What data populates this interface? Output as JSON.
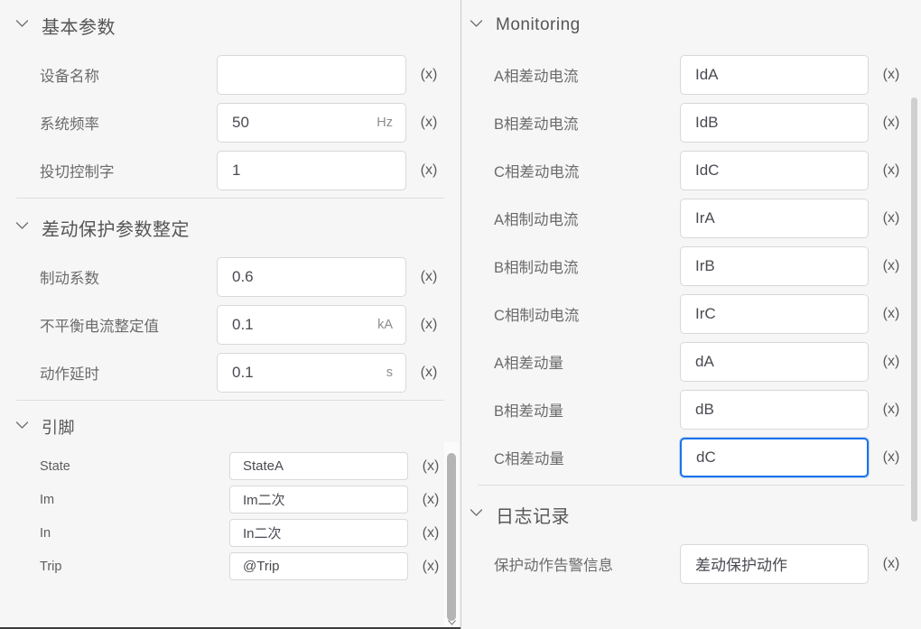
{
  "icons": {
    "chevron": "chevron-down-icon",
    "expression": "(x)"
  },
  "colors": {
    "focus_border": "#1a73e8",
    "panel_bg": "#f6f6f6",
    "field_bg": "#ffffff",
    "field_border": "#d8d8d8",
    "label_text": "#6b6b6b",
    "title_text": "#555555"
  },
  "left_panel": {
    "sections": [
      {
        "title": "基本参数",
        "collapsed": false,
        "rows": [
          {
            "label": "设备名称",
            "value": "",
            "unit": "",
            "expr": "(x)",
            "focused": false
          },
          {
            "label": "系统频率",
            "value": "50",
            "unit": "Hz",
            "expr": "(x)",
            "focused": false
          },
          {
            "label": "投切控制字",
            "value": "1",
            "unit": "",
            "expr": "(x)",
            "focused": false
          }
        ]
      },
      {
        "title": "差动保护参数整定",
        "collapsed": false,
        "rows": [
          {
            "label": "制动系数",
            "value": "0.6",
            "unit": "",
            "expr": "(x)",
            "focused": false
          },
          {
            "label": "不平衡电流整定值",
            "value": "0.1",
            "unit": "kA",
            "expr": "(x)",
            "focused": false
          },
          {
            "label": "动作延时",
            "value": "0.1",
            "unit": "s",
            "expr": "(x)",
            "focused": false
          }
        ]
      },
      {
        "title": "引脚",
        "collapsed": false,
        "compact": true,
        "rows": [
          {
            "label": "State",
            "value": "StateA",
            "unit": "",
            "expr": "(x)",
            "focused": false
          },
          {
            "label": "Im",
            "value": "Im二次",
            "unit": "",
            "expr": "(x)",
            "focused": false
          },
          {
            "label": "In",
            "value": "In二次",
            "unit": "",
            "expr": "(x)",
            "focused": false
          },
          {
            "label": "Trip",
            "value": "@Trip",
            "unit": "",
            "expr": "(x)",
            "focused": false
          }
        ]
      }
    ]
  },
  "right_panel": {
    "sections": [
      {
        "title": "Monitoring",
        "collapsed": false,
        "rows": [
          {
            "label": "A相差动电流",
            "value": "IdA",
            "unit": "",
            "expr": "(x)",
            "focused": false
          },
          {
            "label": "B相差动电流",
            "value": "IdB",
            "unit": "",
            "expr": "(x)",
            "focused": false
          },
          {
            "label": "C相差动电流",
            "value": "IdC",
            "unit": "",
            "expr": "(x)",
            "focused": false
          },
          {
            "label": "A相制动电流",
            "value": "IrA",
            "unit": "",
            "expr": "(x)",
            "focused": false
          },
          {
            "label": "B相制动电流",
            "value": "IrB",
            "unit": "",
            "expr": "(x)",
            "focused": false
          },
          {
            "label": "C相制动电流",
            "value": "IrC",
            "unit": "",
            "expr": "(x)",
            "focused": false
          },
          {
            "label": "A相差动量",
            "value": "dA",
            "unit": "",
            "expr": "(x)",
            "focused": false
          },
          {
            "label": "B相差动量",
            "value": "dB",
            "unit": "",
            "expr": "(x)",
            "focused": false
          },
          {
            "label": "C相差动量",
            "value": "dC",
            "unit": "",
            "expr": "(x)",
            "focused": true
          }
        ]
      },
      {
        "title": "日志记录",
        "collapsed": false,
        "rows": [
          {
            "label": "保护动作告警信息",
            "value": "差动保护动作",
            "unit": "",
            "expr": "(x)",
            "focused": false
          }
        ]
      }
    ]
  }
}
